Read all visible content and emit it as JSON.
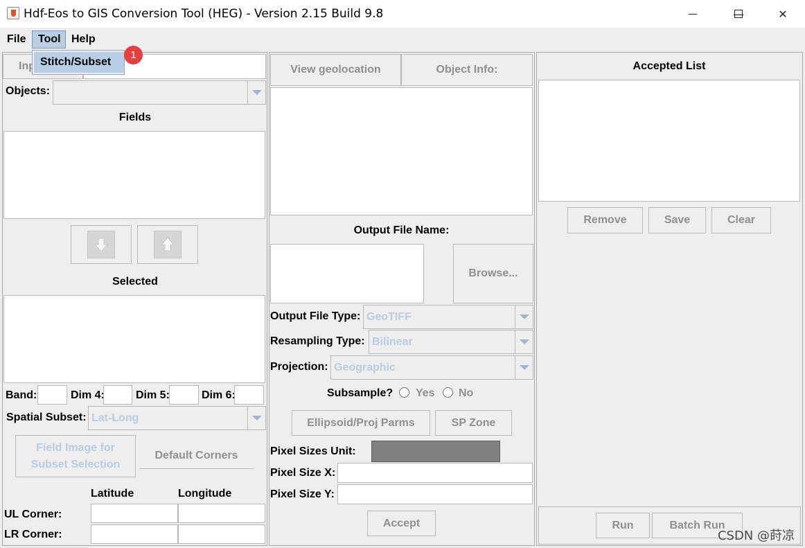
{
  "window": {
    "title": "Hdf-Eos to GIS Conversion Tool (HEG) - Version 2.15 Build 9.8",
    "minimize": "—",
    "maximize": "☐",
    "close": "✕"
  },
  "menu": {
    "items": [
      "File",
      "Tool",
      "Help"
    ],
    "open_item": "Tool",
    "dropdown": [
      "Stitch/Subset"
    ]
  },
  "badge": "1",
  "left": {
    "input_button": "Inp",
    "objects_label": "Objects:",
    "fields_label": "Fields",
    "selected_label": "Selected",
    "band_label": "Band:",
    "dim4_label": "Dim 4:",
    "dim5_label": "Dim 5:",
    "dim6_label": "Dim 6:",
    "spatial_subset_label": "Spatial Subset:",
    "spatial_subset_value": "Lat-Long",
    "field_image_button": "Field Image for Subset Selection",
    "default_corners_button": "Default Corners",
    "latitude_label": "Latitude",
    "longitude_label": "Longitude",
    "ul_corner_label": "UL Corner:",
    "lr_corner_label": "LR Corner:"
  },
  "middle": {
    "view_geolocation_button": "View geolocation",
    "object_info_button": "Object Info:",
    "output_file_name_label": "Output File Name:",
    "browse_button": "Browse...",
    "output_file_type_label": "Output File Type:",
    "output_file_type_value": "GeoTIFF",
    "resampling_type_label": "Resampling Type:",
    "resampling_type_value": "Bilinear",
    "projection_label": "Projection:",
    "projection_value": "Geographic",
    "subsample_label": "Subsample?",
    "yes_label": "Yes",
    "no_label": "No",
    "ellipsoid_button": "Ellipsoid/Proj Parms",
    "sp_zone_button": "SP Zone",
    "pixel_sizes_unit_label": "Pixel Sizes Unit:",
    "pixel_size_x_label": "Pixel Size X:",
    "pixel_size_y_label": "Pixel Size Y:",
    "accept_button": "Accept"
  },
  "right": {
    "accepted_list_label": "Accepted List",
    "remove_button": "Remove",
    "save_button": "Save",
    "clear_button": "Clear",
    "run_button": "Run",
    "batch_run_button": "Batch Run"
  },
  "watermark": "CSDN @莳凉",
  "colors": {
    "menu_highlight": "#b8cfe5",
    "disabled_text": "#8f8f8f",
    "combo_text": "#b8cde3",
    "badge": "#e53f3f",
    "pixel_unit_fill": "#808080"
  }
}
